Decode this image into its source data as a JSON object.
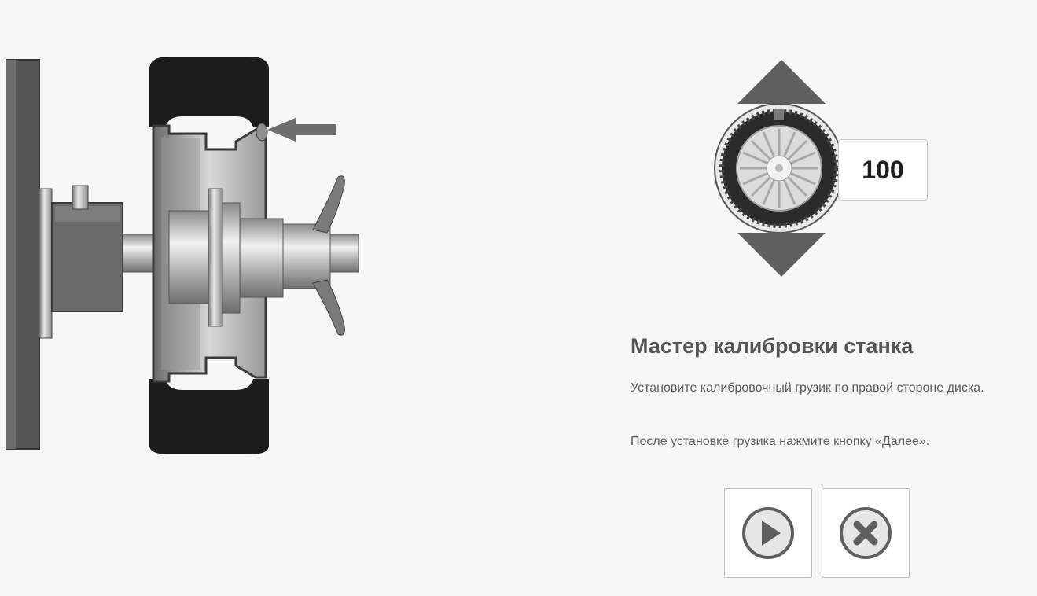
{
  "wizard": {
    "title": "Мастер калибровки станка",
    "instruction_1": "Установите калибровочный грузик по правой стороне диска.",
    "instruction_2": "После установке грузика нажмите кнопку «Далее»."
  },
  "weight_display": {
    "value": "100"
  },
  "buttons": {
    "next_icon": "play-icon",
    "cancel_icon": "close-icon"
  },
  "colors": {
    "background": "#f7f7f7",
    "icon_gray": "#5f5f5f",
    "tire": "#1c1c1c"
  }
}
